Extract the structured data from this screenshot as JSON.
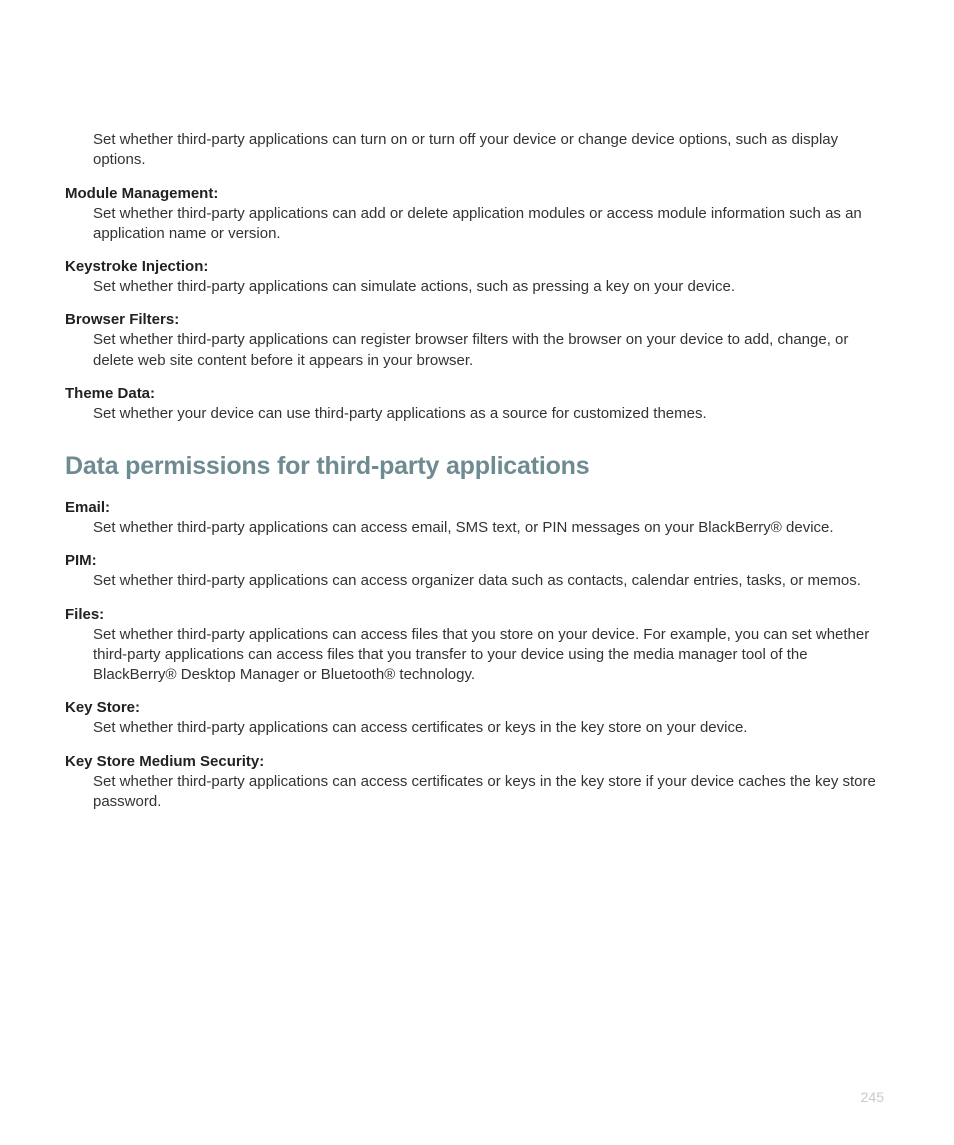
{
  "section1": {
    "orphan_def": "Set whether third-party applications can turn on or turn off your device or change device options, such as display options.",
    "items": [
      {
        "term": "Module Management:",
        "def": "Set whether third-party applications can add or delete application modules or access module information such as an application name or version."
      },
      {
        "term": "Keystroke Injection:",
        "def": "Set whether third-party applications can simulate actions, such as pressing a key on your device."
      },
      {
        "term": "Browser Filters:",
        "def": "Set whether third-party applications can register browser filters with the browser on your device to add, change, or delete web site content before it appears in your browser."
      },
      {
        "term": "Theme Data:",
        "def": "Set whether your device can use third-party applications as a source for customized themes."
      }
    ]
  },
  "heading": "Data permissions for third-party applications",
  "section2": {
    "items": [
      {
        "term": "Email:",
        "def": "Set whether third-party applications can access email, SMS text, or PIN messages on your BlackBerry® device."
      },
      {
        "term": "PIM:",
        "def": "Set whether third-party applications can access organizer data such as contacts, calendar entries, tasks, or memos."
      },
      {
        "term": "Files:",
        "def": "Set whether third-party applications can access files that you store on your device. For example, you can set whether third-party applications can access files that you transfer to your device using the media manager tool of the BlackBerry® Desktop Manager or Bluetooth® technology."
      },
      {
        "term": "Key Store:",
        "def": "Set whether third-party applications can access certificates or keys in the key store on your device."
      },
      {
        "term": "Key Store Medium Security:",
        "def": "Set whether third-party applications can access certificates or keys in the key store if your device caches the key store password."
      }
    ]
  },
  "page_number": "245"
}
